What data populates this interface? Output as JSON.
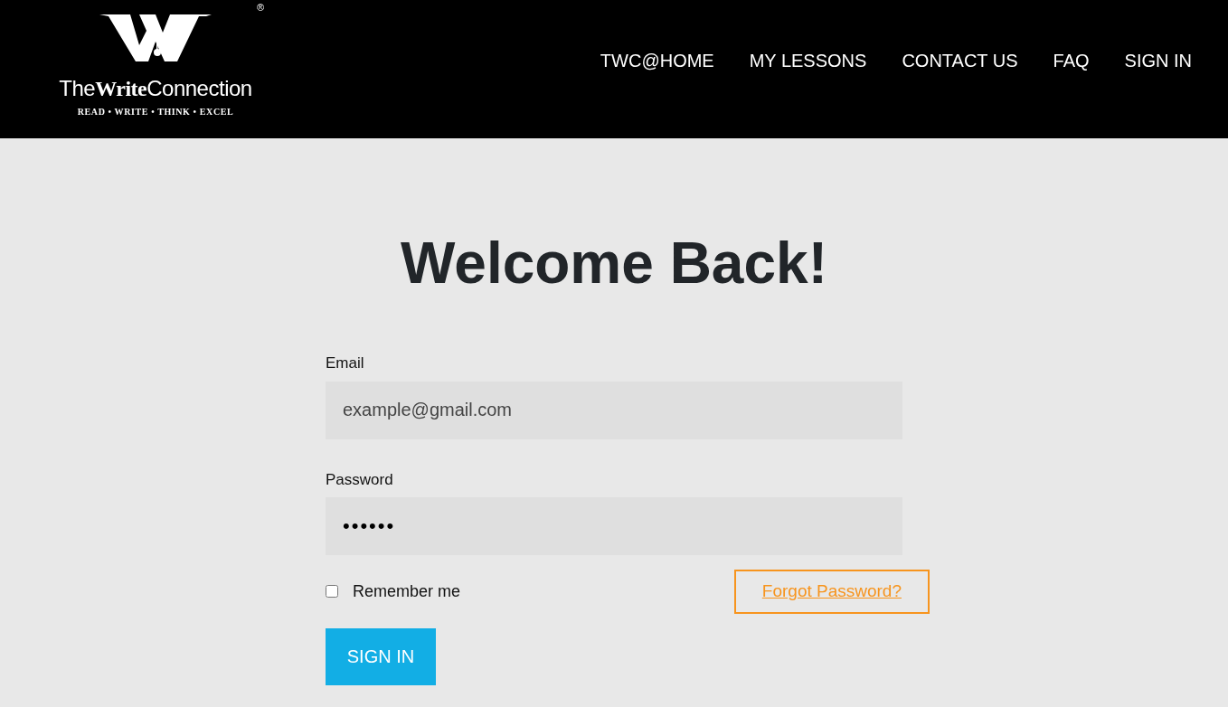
{
  "header": {
    "logo": {
      "registered": "®",
      "name": "The**Write**Connection",
      "tagline": "READ • WRITE • THINK • EXCEL"
    },
    "nav": [
      {
        "label": "TWC@HOME"
      },
      {
        "label": "MY LESSONS"
      },
      {
        "label": "CONTACT US"
      },
      {
        "label": "FAQ"
      },
      {
        "label": "SIGN IN"
      }
    ]
  },
  "heading": "Welcome Back!",
  "form": {
    "email": {
      "label": "Email",
      "placeholder": "example@gmail.com"
    },
    "password": {
      "label": "Password",
      "value": "••••••"
    },
    "remember": {
      "label": "Remember me",
      "checked": false
    },
    "forgot": {
      "label": "Forgot Password?",
      "focused": true
    },
    "submit": "SIGN IN"
  }
}
